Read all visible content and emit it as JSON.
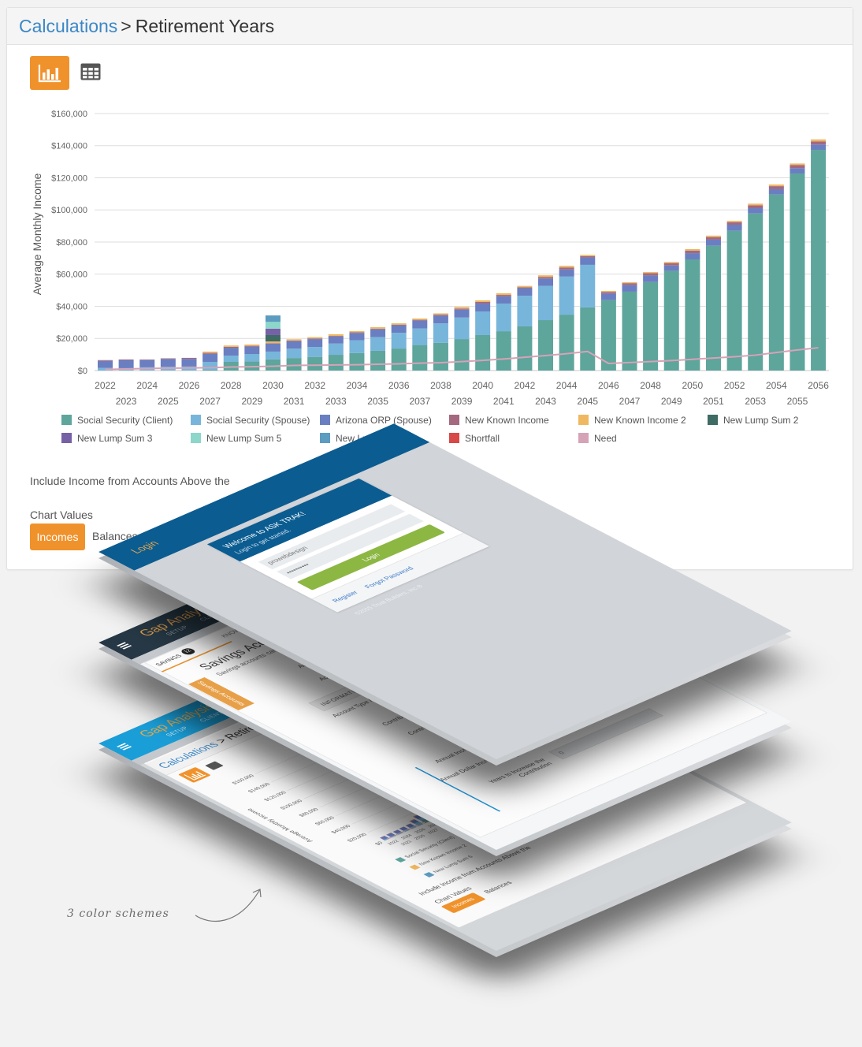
{
  "breadcrumb": {
    "parent": "Calculations",
    "separator": ">",
    "current": "Retirement Years"
  },
  "toolbar": {
    "chart_view_icon": "bar-chart-icon",
    "table_view_icon": "table-grid-icon",
    "active_view": "chart",
    "accent_color": "#f0922b"
  },
  "chart_data": {
    "type": "bar",
    "stacked": true,
    "title": "",
    "xlabel": "",
    "ylabel": "Average Monthly Income",
    "ylim": [
      0,
      160000
    ],
    "grid": true,
    "legend_position": "bottom",
    "y_axis": {
      "ticks": [
        {
          "value": 0,
          "label": "$0"
        },
        {
          "value": 20000,
          "label": "$20,000"
        },
        {
          "value": 40000,
          "label": "$40,000"
        },
        {
          "value": 60000,
          "label": "$60,000"
        },
        {
          "value": 80000,
          "label": "$80,000"
        },
        {
          "value": 100000,
          "label": "$100,000"
        },
        {
          "value": 120000,
          "label": "$120,000"
        },
        {
          "value": 140000,
          "label": "$140,000"
        },
        {
          "value": 160000,
          "label": "$160,000"
        }
      ]
    },
    "categories": [
      "2022",
      "2023",
      "2024",
      "2025",
      "2026",
      "2027",
      "2028",
      "2029",
      "2030",
      "2031",
      "2032",
      "2033",
      "2034",
      "2035",
      "2036",
      "2037",
      "2038",
      "2039",
      "2040",
      "2041",
      "2042",
      "2043",
      "2044",
      "2045",
      "2046",
      "2047",
      "2048",
      "2049",
      "2050",
      "2051",
      "2052",
      "2053",
      "2054",
      "2055",
      "2056"
    ],
    "series": [
      {
        "name": "Social Security (Client)",
        "type": "bar",
        "color": "#5ea59c",
        "values": [
          0,
          0,
          0,
          0,
          0,
          500,
          5400,
          5700,
          7000,
          7800,
          8500,
          9800,
          10900,
          12300,
          13700,
          15900,
          17300,
          19600,
          22100,
          24500,
          27500,
          31400,
          34800,
          39300,
          43800,
          49100,
          55100,
          62000,
          69200,
          77700,
          87000,
          97800,
          109600,
          122700,
          137400
        ]
      },
      {
        "name": "Social Security (Spouse)",
        "type": "bar",
        "color": "#77b5db",
        "values": [
          1600,
          1500,
          2000,
          2300,
          2500,
          4900,
          3900,
          4600,
          4800,
          5800,
          6200,
          7000,
          7900,
          8500,
          9800,
          10300,
          12100,
          13400,
          14700,
          17200,
          19100,
          21300,
          23700,
          26500,
          0,
          0,
          0,
          0,
          0,
          0,
          0,
          0,
          0,
          0,
          0
        ]
      },
      {
        "name": "Arizona ORP (Spouse)",
        "type": "bar",
        "color": "#6a7fc1",
        "values": [
          4400,
          4900,
          4500,
          4900,
          4800,
          5000,
          4900,
          4600,
          5000,
          4700,
          4900,
          4400,
          4600,
          4900,
          4700,
          4900,
          4900,
          4900,
          4900,
          4600,
          4700,
          4600,
          4400,
          4600,
          4100,
          4100,
          4100,
          3400,
          3900,
          3800,
          3800,
          3300,
          3300,
          3300,
          3300
        ]
      },
      {
        "name": "New Known Income",
        "type": "bar",
        "color": "#a4697f",
        "values": [
          500,
          500,
          400,
          400,
          600,
          600,
          600,
          500,
          300,
          400,
          400,
          400,
          400,
          400,
          400,
          500,
          500,
          700,
          1000,
          800,
          600,
          1000,
          1300,
          800,
          1000,
          1200,
          1400,
          1500,
          1600,
          1600,
          1600,
          1800,
          1900,
          2000,
          2000
        ]
      },
      {
        "name": "New Known Income 2",
        "type": "bar",
        "color": "#efb860",
        "values": [
          0,
          0,
          0,
          0,
          0,
          800,
          800,
          800,
          1000,
          800,
          800,
          1000,
          800,
          900,
          800,
          800,
          800,
          1000,
          1000,
          1000,
          800,
          1000,
          1000,
          800,
          700,
          600,
          700,
          700,
          900,
          900,
          800,
          1000,
          1000,
          900,
          1200
        ]
      },
      {
        "name": "New Lump Sum 2",
        "type": "bar",
        "color": "#3e6b64",
        "values": [
          0,
          0,
          0,
          0,
          0,
          0,
          0,
          0,
          4000,
          0,
          0,
          0,
          0,
          0,
          0,
          0,
          0,
          0,
          0,
          0,
          0,
          0,
          0,
          0,
          0,
          0,
          0,
          0,
          0,
          0,
          0,
          0,
          0,
          0,
          0
        ]
      },
      {
        "name": "New Lump Sum 3",
        "type": "bar",
        "color": "#7660a6",
        "values": [
          0,
          0,
          0,
          0,
          0,
          0,
          0,
          0,
          4000,
          0,
          0,
          0,
          0,
          0,
          0,
          0,
          0,
          0,
          0,
          0,
          0,
          0,
          0,
          0,
          0,
          0,
          0,
          0,
          0,
          0,
          0,
          0,
          0,
          0,
          0
        ]
      },
      {
        "name": "New Lump Sum 5",
        "type": "bar",
        "color": "#8dd6ca",
        "values": [
          0,
          0,
          0,
          0,
          0,
          0,
          0,
          0,
          4200,
          0,
          0,
          0,
          0,
          0,
          0,
          0,
          0,
          0,
          0,
          0,
          0,
          0,
          0,
          0,
          0,
          0,
          0,
          0,
          0,
          0,
          0,
          0,
          0,
          0,
          0
        ]
      },
      {
        "name": "New Lump Sum 6",
        "type": "bar",
        "color": "#5b9cc0",
        "values": [
          0,
          0,
          0,
          0,
          0,
          0,
          0,
          0,
          4000,
          0,
          0,
          0,
          0,
          0,
          0,
          0,
          0,
          0,
          0,
          0,
          0,
          0,
          0,
          0,
          0,
          0,
          0,
          0,
          0,
          0,
          0,
          0,
          0,
          0,
          0
        ]
      },
      {
        "name": "Shortfall",
        "type": "bar",
        "color": "#d94848",
        "values": [
          0,
          0,
          0,
          0,
          0,
          0,
          0,
          0,
          0,
          0,
          0,
          0,
          0,
          0,
          0,
          0,
          0,
          0,
          0,
          0,
          0,
          0,
          0,
          0,
          0,
          0,
          0,
          0,
          0,
          0,
          0,
          0,
          0,
          0,
          0
        ]
      },
      {
        "name": "Need",
        "type": "line",
        "color": "#d6a3b6",
        "values": [
          700,
          1000,
          1300,
          1500,
          1600,
          1800,
          2200,
          2400,
          2700,
          3200,
          3300,
          3500,
          3600,
          3900,
          4200,
          4600,
          4900,
          5600,
          6300,
          7200,
          8300,
          9300,
          10500,
          11900,
          4400,
          5000,
          5600,
          6200,
          7000,
          7800,
          8600,
          9600,
          11200,
          12800,
          14200
        ]
      }
    ]
  },
  "controls": {
    "include_income_label": "Include Income from Accounts Above the",
    "chart_values_label": "Chart Values",
    "chart_values_options": [
      {
        "label": "Incomes",
        "active": true
      },
      {
        "label": "Balances",
        "active": false
      }
    ]
  },
  "mockup_layers": {
    "login_screen": {
      "header_title": "Login",
      "welcome_title": "Welcome to ASK TRAK!",
      "welcome_subtitle": "Login to get started.",
      "username_value": "prowebdesign",
      "password_value": "••••••••••",
      "login_button": "Login",
      "links": [
        "Register",
        "Forgot Password"
      ],
      "copyright": "©2015 Trust Builders, Inc.®",
      "colors": {
        "header": "#0b5c91",
        "button": "#8cb743",
        "title": "#e8a94d"
      }
    },
    "dark_scheme": {
      "app_title": "Gap Analysis",
      "nav": [
        "SETUP",
        "CLIENT"
      ],
      "tabs": [
        {
          "label": "SAVINGS",
          "badge": "12"
        },
        {
          "label": "KNOWN I"
        }
      ],
      "heading": "Savings Accounts",
      "subheading": "Savings accounts can",
      "side_button": "Savings Accounts",
      "account_fields": [
        "Account Name",
        "Account Owner"
      ],
      "section_title": "INFORMATION",
      "info_fields": [
        "Account Type / Contribution",
        "Contribution Method",
        "Contribution(s) per",
        "Contribution",
        "Annual Increase Method",
        "Annual Dollar Increase in Each Deposit",
        "Years to Increase the Contribution"
      ],
      "last_field_value": "0",
      "colors": {
        "header": "#263845",
        "accent": "#e8912d"
      }
    },
    "blue_scheme": {
      "app_title": "Gap Analysis",
      "nav": [
        "SETUP",
        "CLIENT"
      ],
      "breadcrumb_parent": "Calculations",
      "breadcrumb_current": "> Retirement Years",
      "include_income_label": "Include Income from Accounts Above the",
      "chart_values_label": "Chart Values",
      "options": [
        "Incomes",
        "Balances"
      ],
      "colors": {
        "header": "#1a9ed8"
      }
    }
  },
  "annotation": {
    "text": "3 color schemes"
  }
}
